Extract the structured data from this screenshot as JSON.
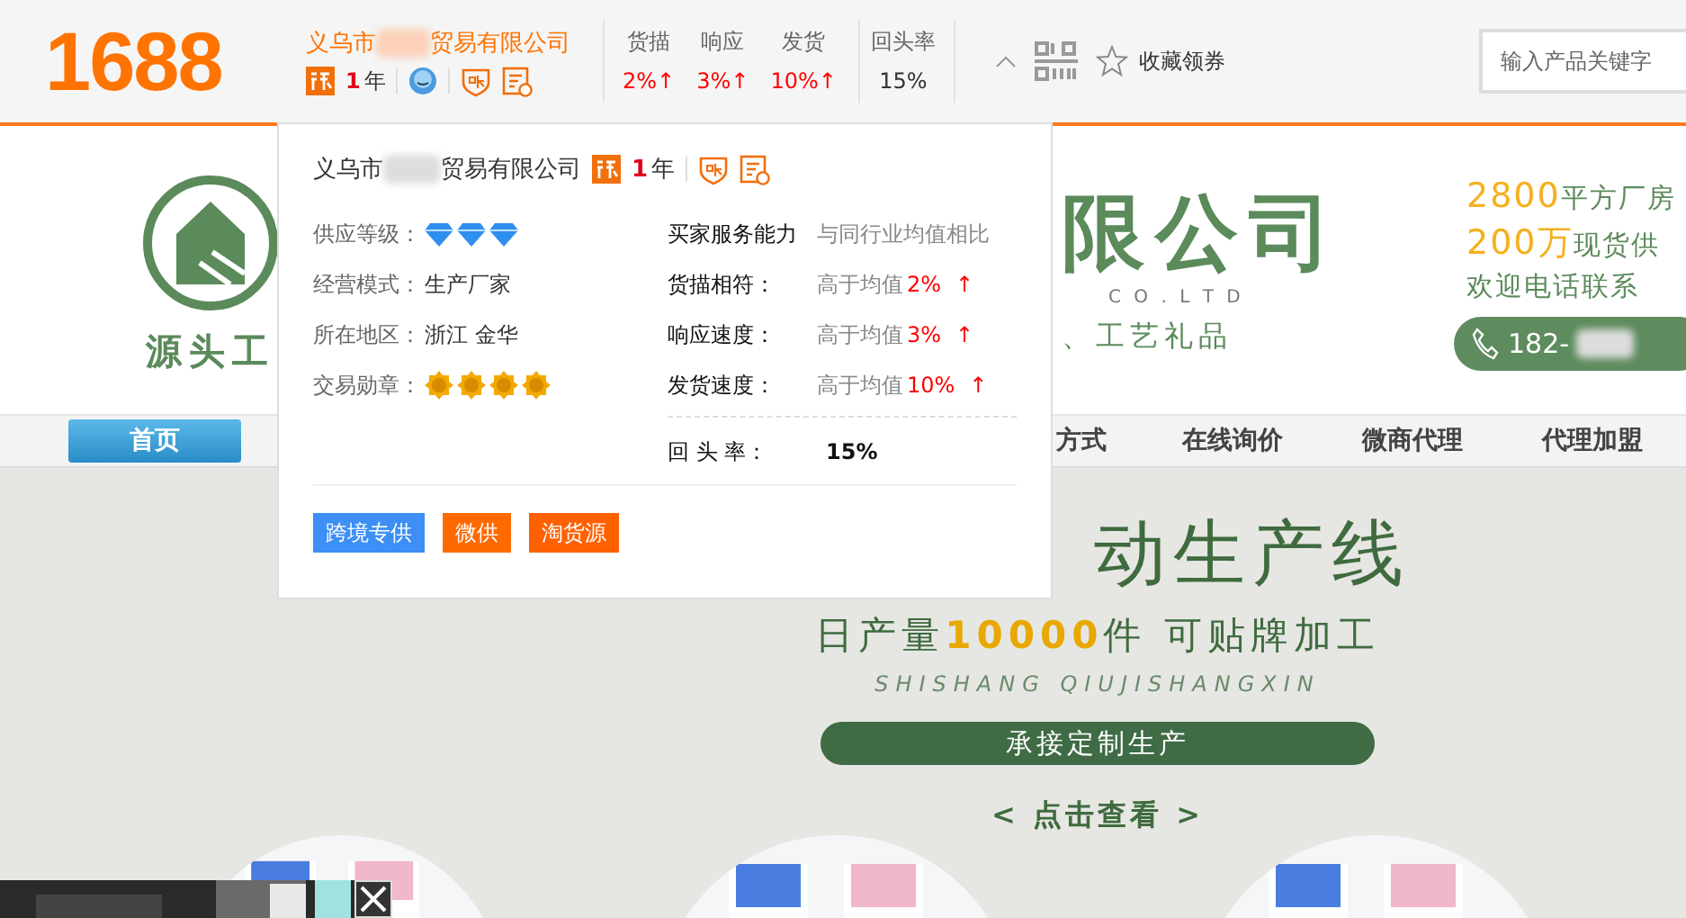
{
  "header": {
    "logo": "1688",
    "company_prefix": "义乌市",
    "company_suffix": "贸易有限公司",
    "years_number": "1",
    "years_unit": "年",
    "stats": [
      {
        "label": "货描",
        "value": "2%↑",
        "above_average": true
      },
      {
        "label": "响应",
        "value": "3%↑",
        "above_average": true
      },
      {
        "label": "发货",
        "value": "10%↑",
        "above_average": true
      },
      {
        "label": "回头率",
        "value": "15%",
        "above_average": false
      }
    ],
    "favorite": "收藏领券",
    "search": {
      "placeholder": "输入产品关键字"
    }
  },
  "popup": {
    "company_prefix": "义乌市",
    "company_suffix": "贸易有限公司",
    "years_number": "1",
    "years_unit": "年",
    "info": [
      {
        "label": "供应等级：",
        "kind": "icons",
        "icons": [
          {
            "kind": "diamond"
          },
          {
            "kind": "diamond"
          },
          {
            "kind": "diamond"
          }
        ]
      },
      {
        "label": "经营模式：",
        "kind": "text",
        "value": "生产厂家"
      },
      {
        "label": "所在地区：",
        "kind": "text",
        "value": "浙江 金华"
      },
      {
        "label": "交易勋章：",
        "kind": "icons",
        "icons": [
          {
            "kind": "medal"
          },
          {
            "kind": "medal"
          },
          {
            "kind": "medal"
          },
          {
            "kind": "medal"
          }
        ]
      }
    ],
    "service_title": "买家服务能力",
    "service_compare": "与同行业均值相比",
    "service": [
      {
        "label": "货描相符：",
        "text": "高于均值",
        "value": "2%",
        "arrow": "↑"
      },
      {
        "label": "响应速度：",
        "text": "高于均值",
        "value": "3%",
        "arrow": "↑"
      },
      {
        "label": "发货速度：",
        "text": "高于均值",
        "value": "10%",
        "arrow": "↑"
      }
    ],
    "repeat_label": "回 头 率：",
    "repeat_value": "15%",
    "tags": [
      {
        "label": "跨境专供",
        "color": "#3d8ff5"
      },
      {
        "label": "微供",
        "color": "#ff6a00"
      },
      {
        "label": "淘货源",
        "color": "#ff6000"
      }
    ]
  },
  "banner": {
    "logo_text": "源头工",
    "name": "限公司",
    "name_en": "C O . L T D",
    "products": "、工艺礼品",
    "lines": [
      {
        "highlight": "2800",
        "text": "平方厂房"
      },
      {
        "highlight": "200万",
        "text": "现货供"
      },
      {
        "text": "欢迎电话联系"
      }
    ],
    "phone": "182-"
  },
  "nav": [
    {
      "label": "首页",
      "selected": true
    },
    {
      "label": "方式",
      "selected": false
    },
    {
      "label": "在线询价",
      "selected": false
    },
    {
      "label": "微商代理",
      "selected": false
    },
    {
      "label": "代理加盟",
      "selected": false
    }
  ],
  "hero": {
    "title": "动生产线",
    "subtitle_a": "日产量",
    "subtitle_num": "10000",
    "subtitle_b": "件 可贴牌加工",
    "pinyin": "SHISHANG QIUJISHANGXIN",
    "button": "承接定制生产",
    "link": "< 点击查看 >"
  }
}
